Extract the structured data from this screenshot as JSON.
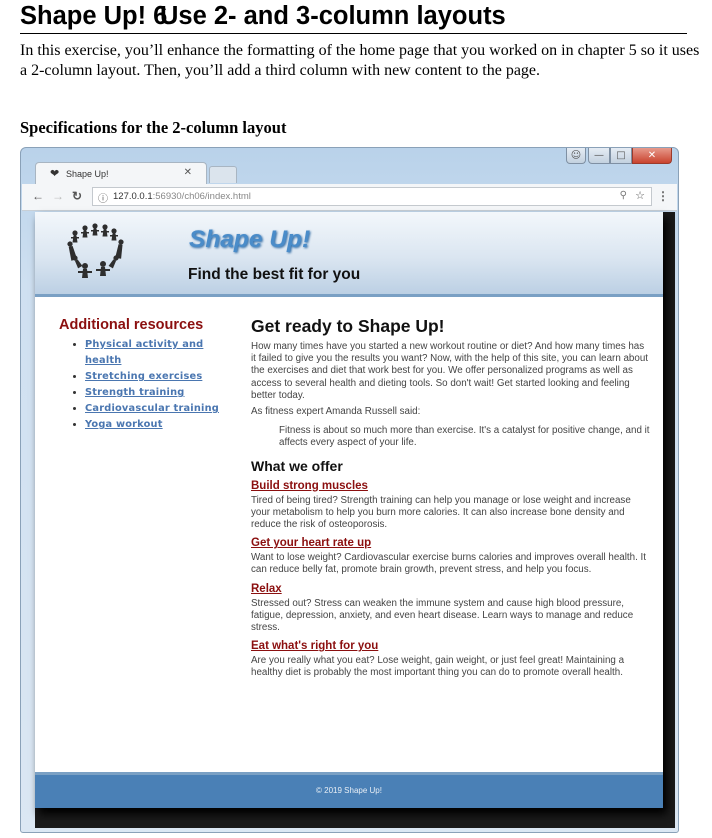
{
  "doc": {
    "chapter_label": "Shape Up! 6",
    "title": "Use 2- and 3-column layouts",
    "intro": "In this exercise, you’ll enhance the formatting of the home page that you worked on in chapter 5 so it uses a 2-column layout. Then, you’ll add a third column with new content to the page.",
    "subheading": "Specifications for the 2-column layout"
  },
  "browser": {
    "tab_title": "Shape Up!",
    "tab_icon": "heart-icon",
    "url_host": "127.0.0.1",
    "url_rest": ":56930/ch06/index.html",
    "window_controls": [
      "user",
      "minimize",
      "maximize",
      "close"
    ]
  },
  "site": {
    "title": "Shape Up!",
    "tagline": "Find the best fit for you",
    "aside": {
      "heading": "Additional resources",
      "links": [
        "Physical activity and health",
        "Stretching exercises",
        "Strength training",
        "Cardiovascular training",
        "Yoga workout"
      ]
    },
    "main": {
      "heading": "Get ready to Shape Up!",
      "intro": "How many times have you started a new workout routine or diet? And how many times has it failed to give you the results you want? Now, with the help of this site, you can learn about the exercises and diet that work best for you. We offer personalized programs as well as access to several health and dieting tools. So don't wait! Get started looking and feeling better today.",
      "quote_intro": "As fitness expert Amanda Russell said:",
      "quote": "Fitness is about so much more than exercise. It's a catalyst for positive change, and it affects every aspect of your life.",
      "offer_heading": "What we offer",
      "offers": [
        {
          "title": "Build strong muscles",
          "text": "Tired of being tired? Strength training can help you manage or lose weight and increase your metabolism to help you burn more calories. It can also increase bone density and reduce the risk of osteoporosis."
        },
        {
          "title": "Get your heart rate up",
          "text": "Want to lose weight? Cardiovascular exercise burns calories and improves overall health. It can reduce belly fat, promote brain growth, prevent stress, and help you focus."
        },
        {
          "title": "Relax",
          "text": "Stressed out? Stress can weaken the immune system and cause high blood pressure, fatigue, depression, anxiety, and even heart disease. Learn ways to manage and reduce stress."
        },
        {
          "title": "Eat what's right for you",
          "text": "Are you really what you eat? Lose weight, gain weight, or just feel great! Maintaining a healthy diet is probably the most important thing you can do to promote overall health."
        }
      ]
    },
    "footer": "© 2019 Shape Up!"
  },
  "colors": {
    "site_title": "#4a8cc9",
    "aside_heading": "#8b0f0f",
    "link": "#4a76b0",
    "offer_link": "#8b0f0f",
    "footer_bg": "#4a80b6"
  }
}
